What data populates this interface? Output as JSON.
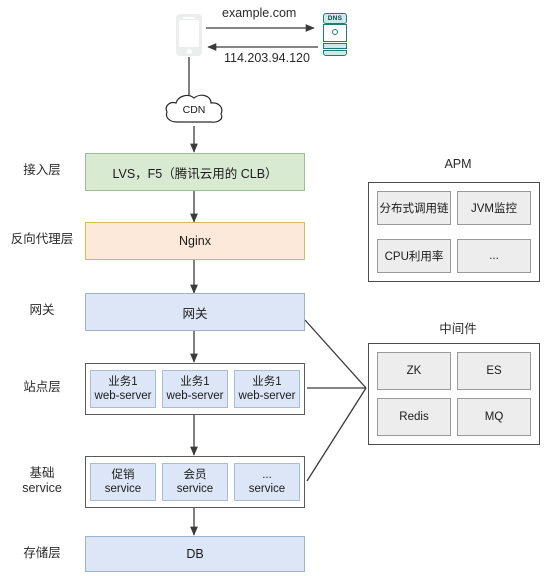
{
  "diagram": {
    "top": {
      "client_icon": "smartphone-icon",
      "dns_icon": "dns-server-icon",
      "dns_label": "DNS",
      "request_label": "example.com",
      "response_label": "114.203.94.120",
      "cdn_label": "CDN"
    },
    "rows": [
      {
        "label": "接入层"
      },
      {
        "label": "反向代理层"
      },
      {
        "label": "网关"
      },
      {
        "label": "站点层"
      },
      {
        "label": "基础\nservice",
        "line1": "基础",
        "line2": "service"
      },
      {
        "label": "存储层"
      }
    ],
    "layers": {
      "access": {
        "text": "LVS，F5（腾讯云用的 CLB）",
        "color": "#d9ead3"
      },
      "proxy": {
        "text": "Nginx",
        "color": "#fde9d9"
      },
      "gateway": {
        "text": "网关",
        "color": "#dce6f7"
      },
      "site": [
        {
          "line1": "业务1",
          "line2": "web-server"
        },
        {
          "line1": "业务1",
          "line2": "web-server"
        },
        {
          "line1": "业务1",
          "line2": "web-server"
        }
      ],
      "service": [
        {
          "line1": "促销",
          "line2": "service"
        },
        {
          "line1": "会员",
          "line2": "service"
        },
        {
          "line1": "...",
          "line2": "service"
        }
      ],
      "storage": {
        "text": "DB",
        "color": "#dce6f7"
      }
    },
    "apm": {
      "title": "APM",
      "tiles": [
        "分布式调用链",
        "JVM监控",
        "CPU利用率",
        "..."
      ]
    },
    "middleware": {
      "title": "中间件",
      "tiles": [
        "ZK",
        "ES",
        "Redis",
        "MQ"
      ]
    }
  }
}
